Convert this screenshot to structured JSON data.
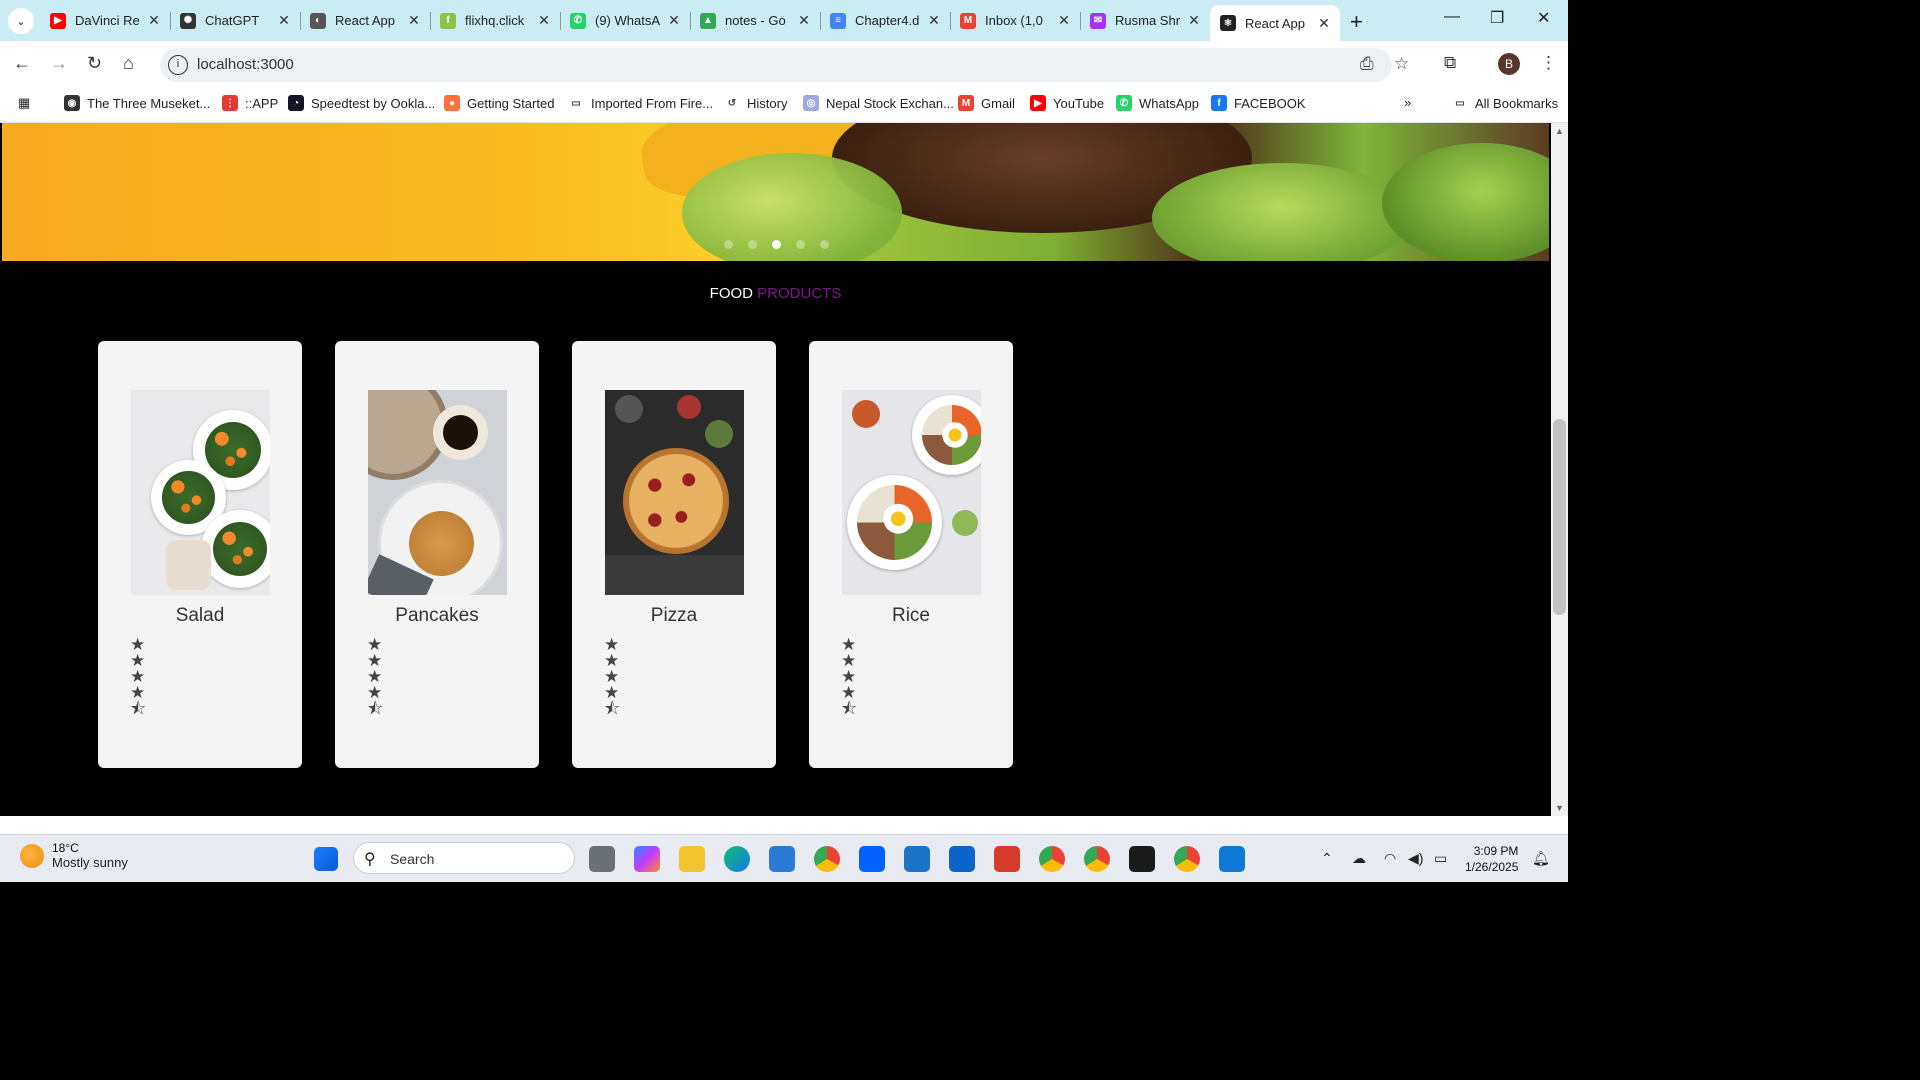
{
  "browser": {
    "tabs": [
      {
        "title": "DaVinci Re",
        "color": "#ff0000",
        "glyph": "▶"
      },
      {
        "title": "ChatGPT",
        "color": "#333333",
        "glyph": "✺"
      },
      {
        "title": "React App",
        "color": "#555555",
        "glyph": "◐"
      },
      {
        "title": "flixhq.click",
        "color": "#8bc34a",
        "glyph": "f"
      },
      {
        "title": "(9) WhatsA",
        "color": "#25d366",
        "glyph": "✆"
      },
      {
        "title": "notes - Go",
        "color": "#34a853",
        "glyph": "▲"
      },
      {
        "title": "Chapter4.d",
        "color": "#4285f4",
        "glyph": "≡"
      },
      {
        "title": "Inbox (1,0",
        "color": "#ea4335",
        "glyph": "M"
      },
      {
        "title": "Rusma Shr",
        "color": "#a033ff",
        "glyph": "✉"
      },
      {
        "title": "React App",
        "color": "#222222",
        "glyph": "⚛"
      }
    ],
    "active_tab": 9,
    "url": "localhost:3000",
    "avatar": "B",
    "bookmarks": [
      {
        "label": "The Three Museket...",
        "color": "#333333",
        "glyph": "◉"
      },
      {
        "label": "::APP",
        "color": "#e53935",
        "glyph": "⋮"
      },
      {
        "label": "Speedtest by Ookla...",
        "color": "#141526",
        "glyph": "◔"
      },
      {
        "label": "Getting Started",
        "color": "#ff7139",
        "glyph": "●"
      },
      {
        "label": "Imported From Fire...",
        "color": "#ffffff",
        "glyph": "▭"
      },
      {
        "label": "History",
        "color": "#ffffff",
        "glyph": "↺"
      },
      {
        "label": "Nepal Stock Exchan...",
        "color": "#9fa8da",
        "glyph": "◎"
      },
      {
        "label": "Gmail",
        "color": "#ea4335",
        "glyph": "M"
      },
      {
        "label": "YouTube",
        "color": "#ff0000",
        "glyph": "▶"
      },
      {
        "label": "WhatsApp",
        "color": "#25d366",
        "glyph": "✆"
      },
      {
        "label": "FACEBOOK",
        "color": "#1877f2",
        "glyph": "f"
      }
    ],
    "all_bookmarks": "All Bookmarks"
  },
  "page": {
    "carousel": {
      "slides": 5,
      "active": 2
    },
    "heading": {
      "part1": "FOOD",
      "part2": "PRODUCTS",
      "accent_color": "#7a1a86"
    },
    "products": [
      {
        "name": "Salad",
        "rating": 4.5
      },
      {
        "name": "Pancakes",
        "rating": 4.5
      },
      {
        "name": "Pizza",
        "rating": 4.5
      },
      {
        "name": "Rice",
        "rating": 4.5
      }
    ]
  },
  "taskbar": {
    "temperature": "18°C",
    "weather": "Mostly sunny",
    "search_placeholder": "Search",
    "time": "3:09 PM",
    "date": "1/26/2025"
  }
}
